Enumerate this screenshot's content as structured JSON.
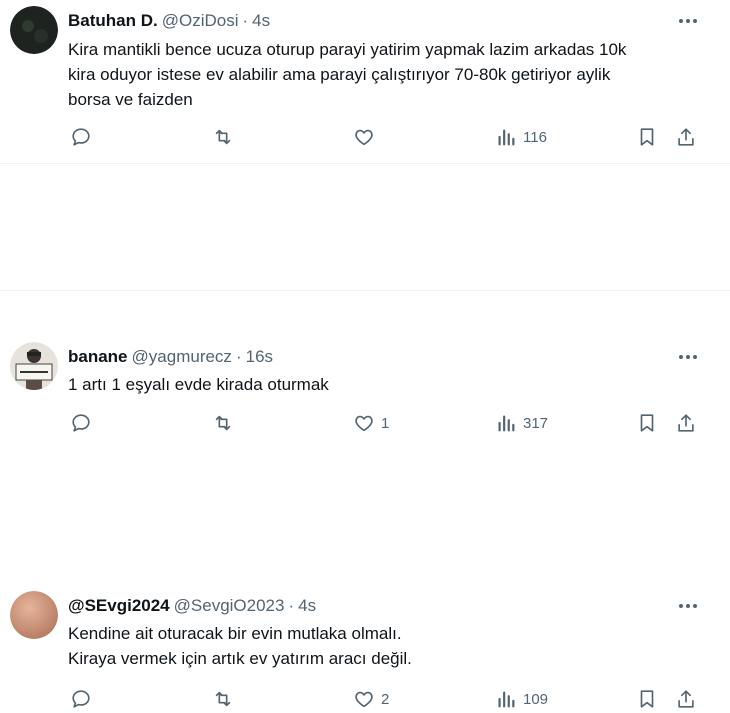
{
  "tweets": [
    {
      "name": "Batuhan D.",
      "handle": "@OziDosi",
      "separator": "·",
      "time": "4s",
      "lines": [
        "Kira mantikli bence ucuza oturup parayi yatirim yapmak lazim arkadas 10k",
        "kira oduyor istese ev alabilir ama parayi çalıştırıyor 70-80k getiriyor aylik",
        "borsa ve faizden"
      ],
      "likes": "",
      "views": "116",
      "avatar_icon": "dark-avatar"
    },
    {
      "name": "banane",
      "handle": "@yagmurecz",
      "separator": "·",
      "time": "16s",
      "lines": [
        "1 artı 1 eşyalı evde kirada oturmak"
      ],
      "likes": "1",
      "views": "317",
      "avatar_icon": "person-with-sign-avatar"
    },
    {
      "name": "@SEvgi2024",
      "handle": "@SevgiO2023",
      "separator": "·",
      "time": "4s",
      "lines": [
        "Kendine ait oturacak bir evin mutlaka olmalı.",
        "Kiraya vermek için artık ev yatırım aracı değil."
      ],
      "likes": "2",
      "views": "109",
      "avatar_icon": "skin-tone-avatar"
    }
  ],
  "icons": {
    "reply": "reply-icon",
    "retweet": "retweet-icon",
    "like": "heart-icon",
    "views": "views-icon",
    "bookmark": "bookmark-icon",
    "share": "share-icon",
    "more": "more-icon"
  },
  "colors": {
    "text": "#0f1419",
    "secondary": "#536471",
    "divider": "#eff3f4"
  }
}
